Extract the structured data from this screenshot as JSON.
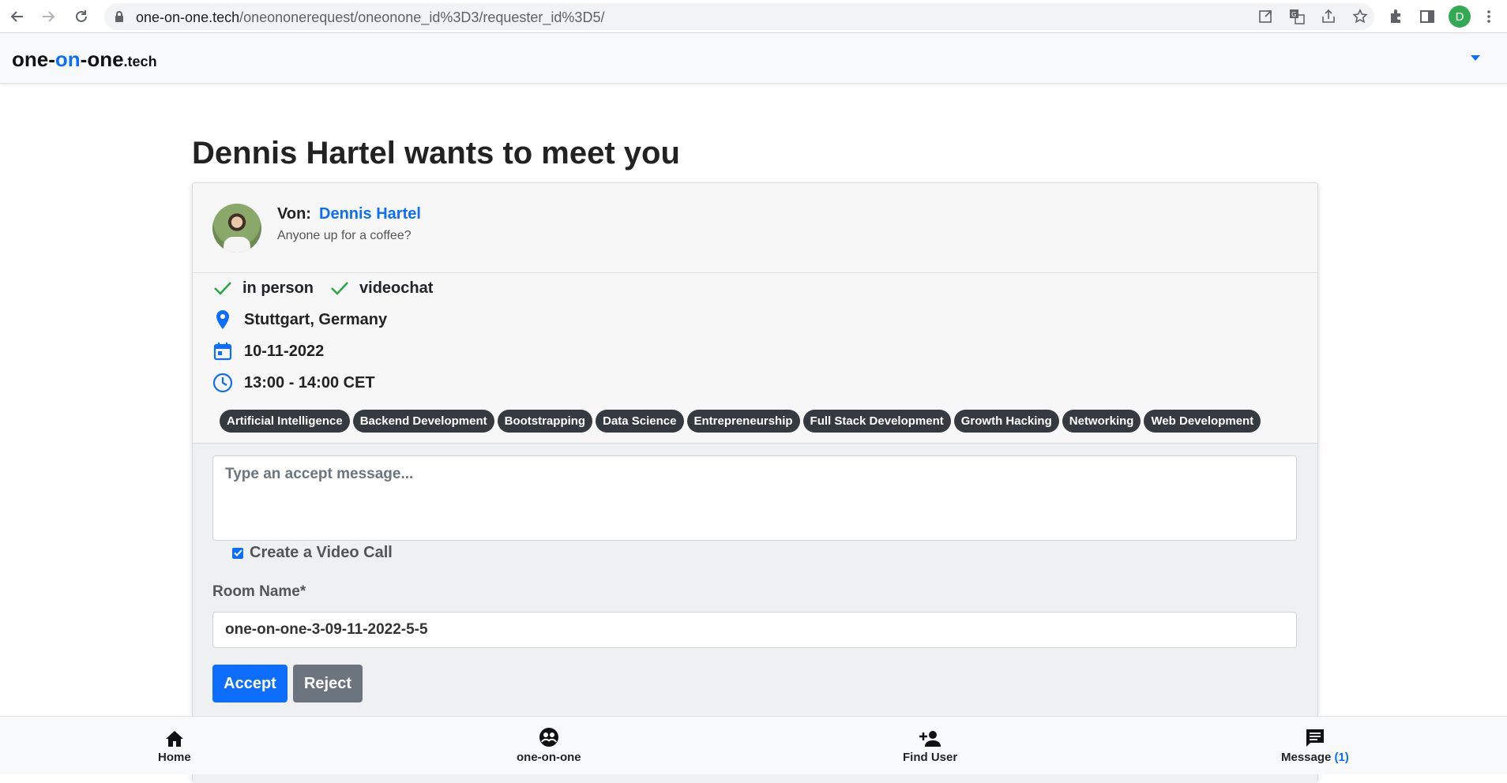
{
  "browser": {
    "url_host": "one-on-one.tech",
    "url_path": "/oneononerequest/oneonone_id%3D3/requester_id%3D5/",
    "profile_initial": "D"
  },
  "navbar": {
    "brand_part1": "one-",
    "brand_part2": "on",
    "brand_part3": "-one",
    "brand_tld": ".tech"
  },
  "page": {
    "title": "Dennis Hartel wants to meet you"
  },
  "request": {
    "from_label": "Von:",
    "from_name": "Dennis Hartel",
    "message": "Anyone up for a coffee?",
    "modes": [
      "in person",
      "videochat"
    ],
    "location": "Stuttgart, Germany",
    "date": "10-11-2022",
    "time": "13:00 - 14:00 CET",
    "tags": [
      "Artificial Intelligence",
      "Backend Development",
      "Bootstrapping",
      "Data Science",
      "Entrepreneurship",
      "Full Stack Development",
      "Growth Hacking",
      "Networking",
      "Web Development"
    ]
  },
  "form": {
    "message_placeholder": "Type an accept message...",
    "video_call_label": "Create a Video Call",
    "video_call_checked": true,
    "room_label": "Room Name*",
    "room_value": "one-on-one-3-09-11-2022-5-5",
    "accept_label": "Accept",
    "reject_label": "Reject"
  },
  "bottom_nav": {
    "home": "Home",
    "oneonone": "one-on-one",
    "find_user": "Find User",
    "message": "Message",
    "message_count": "(1)"
  },
  "colors": {
    "primary": "#0d6efd",
    "secondary": "#6c757d",
    "tag_bg": "#343a40",
    "check_green": "#28a745"
  }
}
